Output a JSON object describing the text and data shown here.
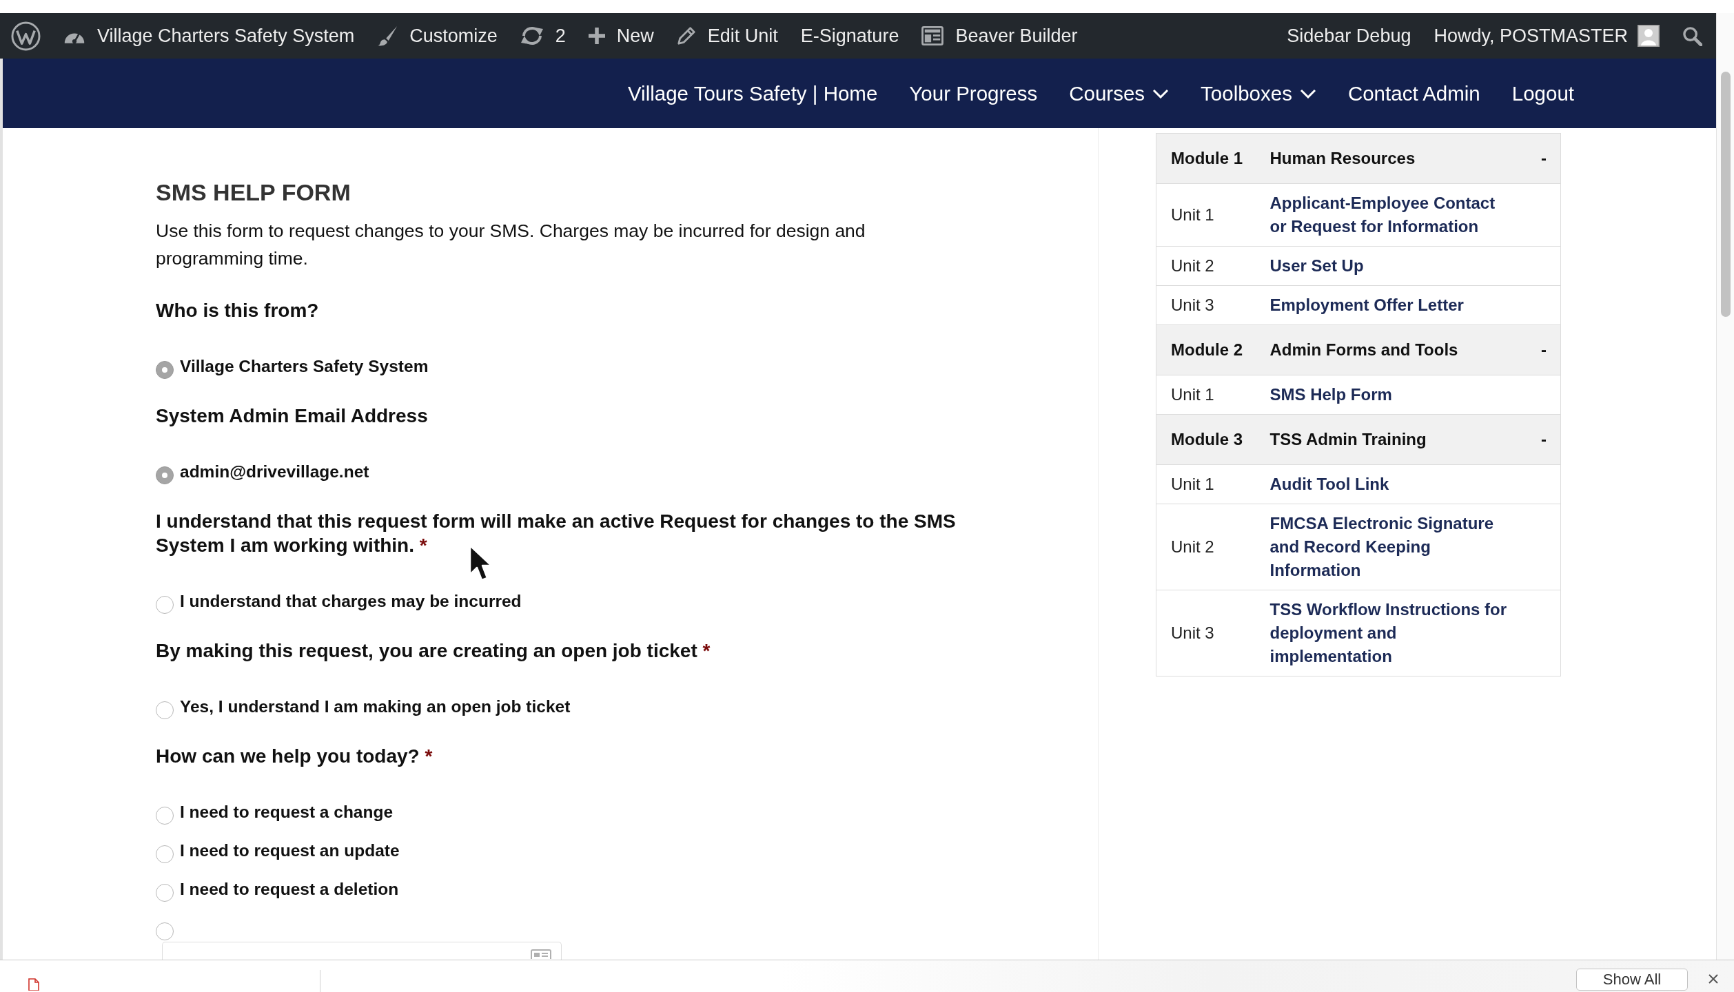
{
  "admin_bar": {
    "left": [
      {
        "kind": "logo"
      },
      {
        "kind": "site",
        "label": "Village Charters Safety System"
      },
      {
        "kind": "customize",
        "label": "Customize"
      },
      {
        "kind": "updates",
        "label": "2"
      },
      {
        "kind": "new",
        "label": "New"
      },
      {
        "kind": "edit",
        "label": "Edit Unit"
      },
      {
        "kind": "plain",
        "label": "E-Signature"
      },
      {
        "kind": "builder",
        "label": "Beaver Builder"
      }
    ],
    "right": [
      {
        "kind": "plain",
        "label": "Sidebar Debug"
      },
      {
        "kind": "account",
        "label": "Howdy, POSTMASTER"
      },
      {
        "kind": "search"
      }
    ]
  },
  "nav": [
    {
      "label": "Village Tours Safety | Home",
      "has_dropdown": false
    },
    {
      "label": "Your Progress",
      "has_dropdown": false
    },
    {
      "label": "Courses",
      "has_dropdown": true
    },
    {
      "label": "Toolboxes",
      "has_dropdown": true
    },
    {
      "label": "Contact Admin",
      "has_dropdown": false
    },
    {
      "label": "Logout",
      "has_dropdown": false
    }
  ],
  "form": {
    "title": "SMS HELP FORM",
    "intro": "Use this form to request changes to your SMS. Charges may be incurred for design and programming time.",
    "questions": [
      {
        "label": "Who is this from?",
        "options": [
          {
            "kind": "choice",
            "label": "Village Charters Safety System",
            "selected": true
          }
        ]
      },
      {
        "label": "System Admin Email Address",
        "options": [
          {
            "kind": "choice",
            "label": "admin@drivevillage.net",
            "selected": true
          }
        ]
      },
      {
        "label": "I understand that this request form will make an active Request for changes to the SMS System I am working within.",
        "required_mark": "*",
        "options": [
          {
            "kind": "choice",
            "label": "I understand that charges may be incurred",
            "selected": false
          }
        ]
      },
      {
        "label": "By making this request, you are creating an open job ticket",
        "required_mark": "*",
        "options": [
          {
            "kind": "choice",
            "label": "Yes, I understand I am making an open job ticket",
            "selected": false
          }
        ]
      },
      {
        "label": "How can we help you today?",
        "required_mark": "*",
        "options": [
          {
            "kind": "choice",
            "label": "I need to request a change",
            "selected": false
          },
          {
            "kind": "choice",
            "label": "I need to request an update",
            "selected": false
          },
          {
            "kind": "choice",
            "label": "I need to request a deletion",
            "selected": false
          },
          {
            "kind": "other",
            "selected": false
          }
        ]
      }
    ]
  },
  "sidebar": {
    "modules": [
      {
        "label": "Module 1",
        "title": "Human Resources",
        "toggle": "-",
        "units": [
          {
            "label": "Unit 1",
            "title": "Applicant-Employee Contact or Request for Information"
          },
          {
            "label": "Unit 2",
            "title": "User Set Up"
          },
          {
            "label": "Unit 3",
            "title": "Employment Offer Letter"
          }
        ]
      },
      {
        "label": "Module 2",
        "title": "Admin Forms and Tools",
        "toggle": "-",
        "units": [
          {
            "label": "Unit 1",
            "title": "SMS Help Form"
          }
        ]
      },
      {
        "label": "Module 3",
        "title": "TSS Admin Training",
        "toggle": "-",
        "units": [
          {
            "label": "Unit 1",
            "title": "Audit Tool Link"
          },
          {
            "label": "Unit 2",
            "title": "FMCSA Electronic Signature and Record Keeping Information"
          },
          {
            "label": "Unit 3",
            "title": "TSS Workflow Instructions for deployment and implementation"
          }
        ]
      }
    ]
  },
  "download_bar": {
    "button": "Show All"
  }
}
